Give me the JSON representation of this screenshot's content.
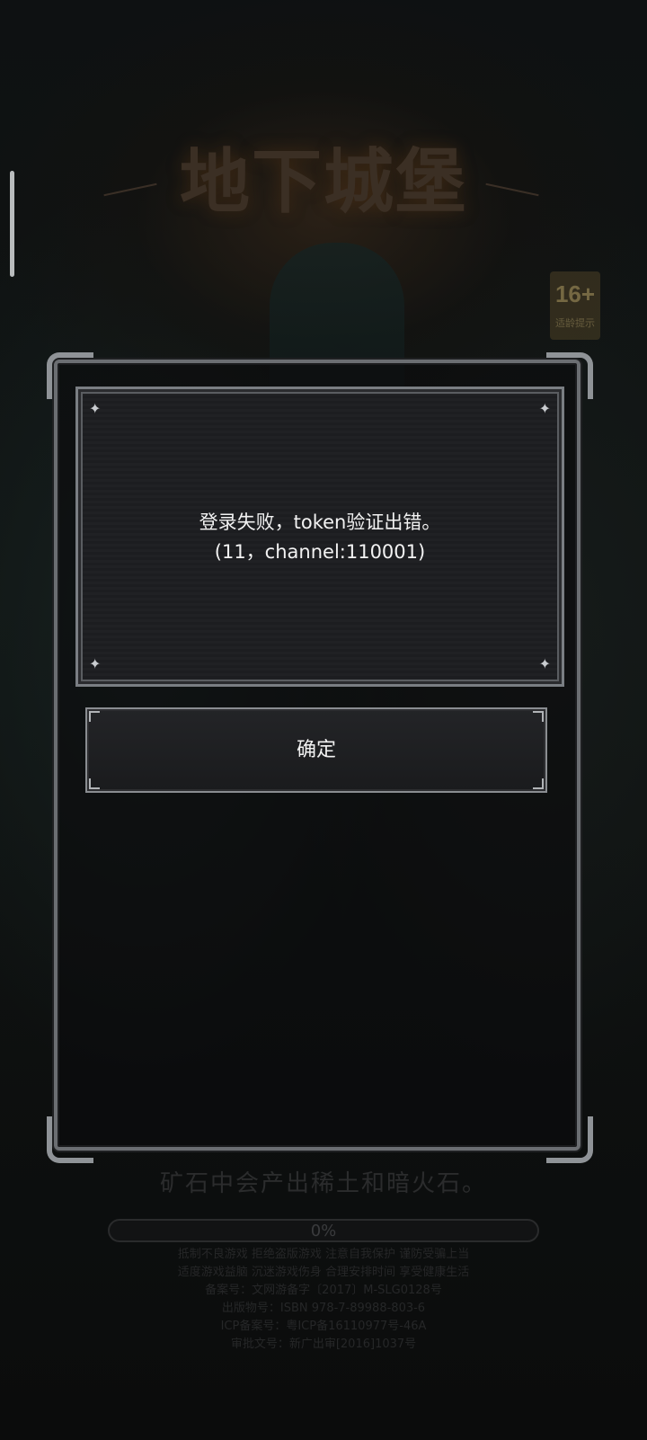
{
  "background": {
    "game_title": "地下城堡",
    "age_rating": {
      "number": "16+",
      "label": "适龄提示"
    },
    "loading_tip": "矿石中会产出稀土和暗火石。",
    "progress": {
      "label": "0%",
      "value": 0
    },
    "notice_lines": [
      "抵制不良游戏  拒绝盗版游戏  注意自我保护  谨防受骗上当",
      "适度游戏益脑  沉迷游戏伤身  合理安排时间  享受健康生活",
      "备案号：文网游备字〔2017〕M-SLG0128号",
      "出版物号：ISBN 978-7-89988-803-6",
      "ICP备案号：粤ICP备16110977号-46A",
      "审批文号：新广出审[2016]1037号"
    ]
  },
  "dialog": {
    "message_line1": "登录失败，token验证出错。",
    "message_line2": "(11，channel:110001)",
    "confirm_label": "确定"
  },
  "colors": {
    "panel_border": "#7a7e83",
    "panel_bg": "#1c1d20",
    "text": "#f2f2f2"
  }
}
